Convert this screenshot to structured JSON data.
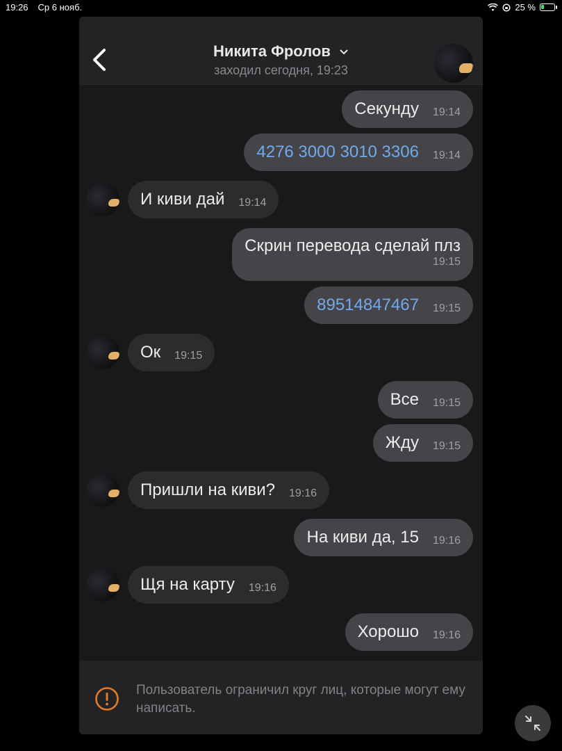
{
  "status_bar": {
    "time": "19:26",
    "date": "Ср 6 нояб.",
    "battery": "25 %",
    "battery_level": 0.25
  },
  "header": {
    "title": "Никита Фролов",
    "subtitle": "заходил сегодня, 19:23"
  },
  "messages": [
    {
      "dir": "out",
      "text": "Секунду",
      "time": "19:14"
    },
    {
      "dir": "out",
      "text": "4276 3000 3010 3306",
      "time": "19:14",
      "link": true
    },
    {
      "dir": "in",
      "text": "И киви дай",
      "time": "19:14"
    },
    {
      "dir": "out",
      "text": "Скрин перевода сделай плз",
      "time": "19:15"
    },
    {
      "dir": "out",
      "text": "89514847467",
      "time": "19:15",
      "link": true
    },
    {
      "dir": "in",
      "text": "Ок",
      "time": "19:15"
    },
    {
      "dir": "out",
      "text": "Все",
      "time": "19:15"
    },
    {
      "dir": "out",
      "text": "Жду",
      "time": "19:15"
    },
    {
      "dir": "in",
      "text": "Пришли на киви?",
      "time": "19:16"
    },
    {
      "dir": "out",
      "text": "На киви да, 15",
      "time": "19:16"
    },
    {
      "dir": "in",
      "text": "Щя на карту",
      "time": "19:16"
    },
    {
      "dir": "out",
      "text": "Хорошо",
      "time": "19:16"
    }
  ],
  "notice": {
    "text": "Пользователь ограничил круг лиц, которые могут ему написать."
  },
  "colors": {
    "accent_link": "#71aaeb",
    "warning": "#e07b2a",
    "bubble_out": "#454549",
    "bubble_in": "#2c2c2e"
  },
  "icons": {
    "back": "chevron-left-icon",
    "title_dropdown": "chevron-down-icon",
    "warning": "exclamation-circle-icon",
    "minimize": "minimize-arrows-icon"
  }
}
